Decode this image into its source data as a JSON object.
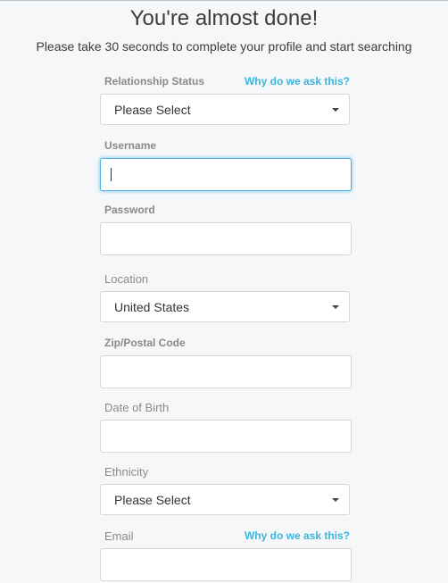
{
  "header": {
    "title": "You're almost done!",
    "subtitle": "Please take 30 seconds to complete your profile and start searching"
  },
  "form": {
    "relationship_status": {
      "label": "Relationship Status",
      "help_link": "Why do we ask this?",
      "value": "Please Select"
    },
    "username": {
      "label": "Username",
      "value": ""
    },
    "password": {
      "label": "Password",
      "value": ""
    },
    "location": {
      "label": "Location",
      "value": "United States"
    },
    "zip": {
      "label": "Zip/Postal Code",
      "value": ""
    },
    "dob": {
      "label": "Date of Birth",
      "value": ""
    },
    "ethnicity": {
      "label": "Ethnicity",
      "value": "Please Select"
    },
    "email": {
      "label": "Email",
      "help_link": "Why do we ask this?",
      "value": ""
    }
  },
  "colors": {
    "accent": "#3bb6de",
    "focus_border": "#4fb4e3",
    "label": "#8a8a8a",
    "background": "#f5f7f9"
  }
}
